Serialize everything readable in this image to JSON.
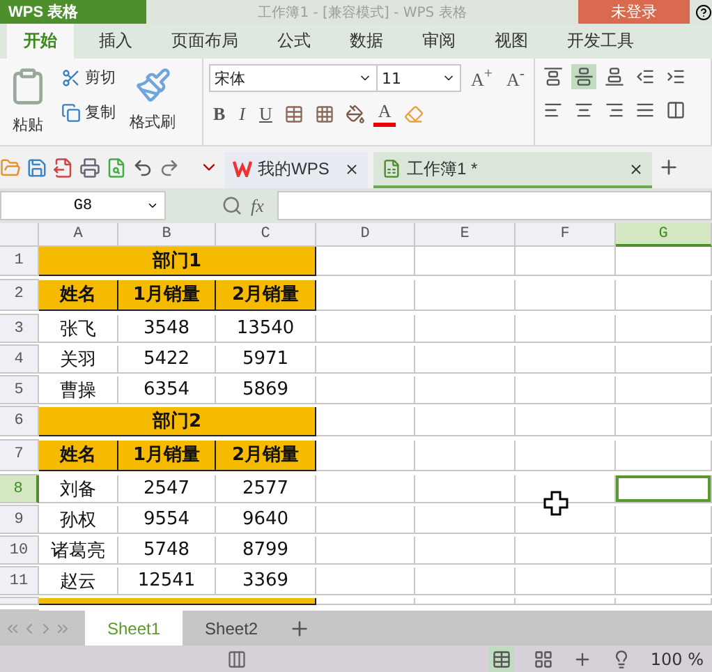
{
  "title_bar": {
    "app": "WPS 表格",
    "title": "工作簿1 - [兼容模式] - WPS 表格",
    "login": "未登录"
  },
  "ribbon_tabs": [
    {
      "label": "开始",
      "selected": true
    },
    {
      "label": "插入",
      "selected": false
    },
    {
      "label": "页面布局",
      "selected": false
    },
    {
      "label": "公式",
      "selected": false
    },
    {
      "label": "数据",
      "selected": false
    },
    {
      "label": "审阅",
      "selected": false
    },
    {
      "label": "视图",
      "selected": false
    },
    {
      "label": "开发工具",
      "selected": false
    }
  ],
  "clipboard": {
    "paste": "粘贴",
    "cut": "剪切",
    "copy": "复制",
    "format_painter": "格式刷"
  },
  "font": {
    "name": "宋体",
    "size": "11",
    "grow": {
      "letter": "A",
      "sign": "+"
    },
    "shrink": {
      "letter": "A",
      "sign": "-"
    },
    "bold": "B",
    "italic": "I",
    "underline": "U",
    "font_color_letter": "A"
  },
  "vertical_align": [
    {
      "selected": false
    },
    {
      "selected": true
    },
    {
      "selected": false
    }
  ],
  "doc_tabs": [
    {
      "kind": "home",
      "label": "我的WPS",
      "selected": false
    },
    {
      "kind": "sheet",
      "label": "工作簿1 *",
      "selected": true
    }
  ],
  "formula_bar": {
    "name_box": "G8",
    "fx": "fx"
  },
  "columns": [
    {
      "label": "A",
      "selected": false
    },
    {
      "label": "B",
      "selected": false
    },
    {
      "label": "C",
      "selected": false
    },
    {
      "label": "D",
      "selected": false
    },
    {
      "label": "E",
      "selected": false
    },
    {
      "label": "F",
      "selected": false
    },
    {
      "label": "G",
      "selected": true
    }
  ],
  "rows": [
    {
      "number": "1",
      "kind": "section",
      "selected": false,
      "cells": [
        "部门1"
      ]
    },
    {
      "number": "2",
      "kind": "header",
      "selected": false,
      "cells": [
        "姓名",
        "1月销量",
        "2月销量"
      ]
    },
    {
      "number": "3",
      "kind": "data",
      "selected": false,
      "cells": [
        "张飞",
        "3548",
        "13540"
      ]
    },
    {
      "number": "4",
      "kind": "data",
      "selected": false,
      "cells": [
        "关羽",
        "5422",
        "5971"
      ]
    },
    {
      "number": "5",
      "kind": "data",
      "selected": false,
      "cells": [
        "曹操",
        "6354",
        "5869"
      ]
    },
    {
      "number": "6",
      "kind": "section",
      "selected": false,
      "cells": [
        "部门2"
      ]
    },
    {
      "number": "7",
      "kind": "header",
      "selected": false,
      "cells": [
        "姓名",
        "1月销量",
        "2月销量"
      ]
    },
    {
      "number": "8",
      "kind": "data",
      "selected": true,
      "cells": [
        "刘备",
        "2547",
        "2577"
      ]
    },
    {
      "number": "9",
      "kind": "data",
      "selected": false,
      "cells": [
        "孙权",
        "9554",
        "9640"
      ]
    },
    {
      "number": "10",
      "kind": "data",
      "selected": false,
      "cells": [
        "诸葛亮",
        "5748",
        "8799"
      ]
    },
    {
      "number": "11",
      "kind": "data",
      "selected": false,
      "cells": [
        "赵云",
        "12541",
        "3369"
      ]
    },
    {
      "kind": "partial_section"
    }
  ],
  "sheet_tabs": [
    {
      "label": "Sheet1",
      "selected": true
    },
    {
      "label": "Sheet2",
      "selected": false
    }
  ],
  "status_bar": {
    "zoom": "100 %"
  }
}
